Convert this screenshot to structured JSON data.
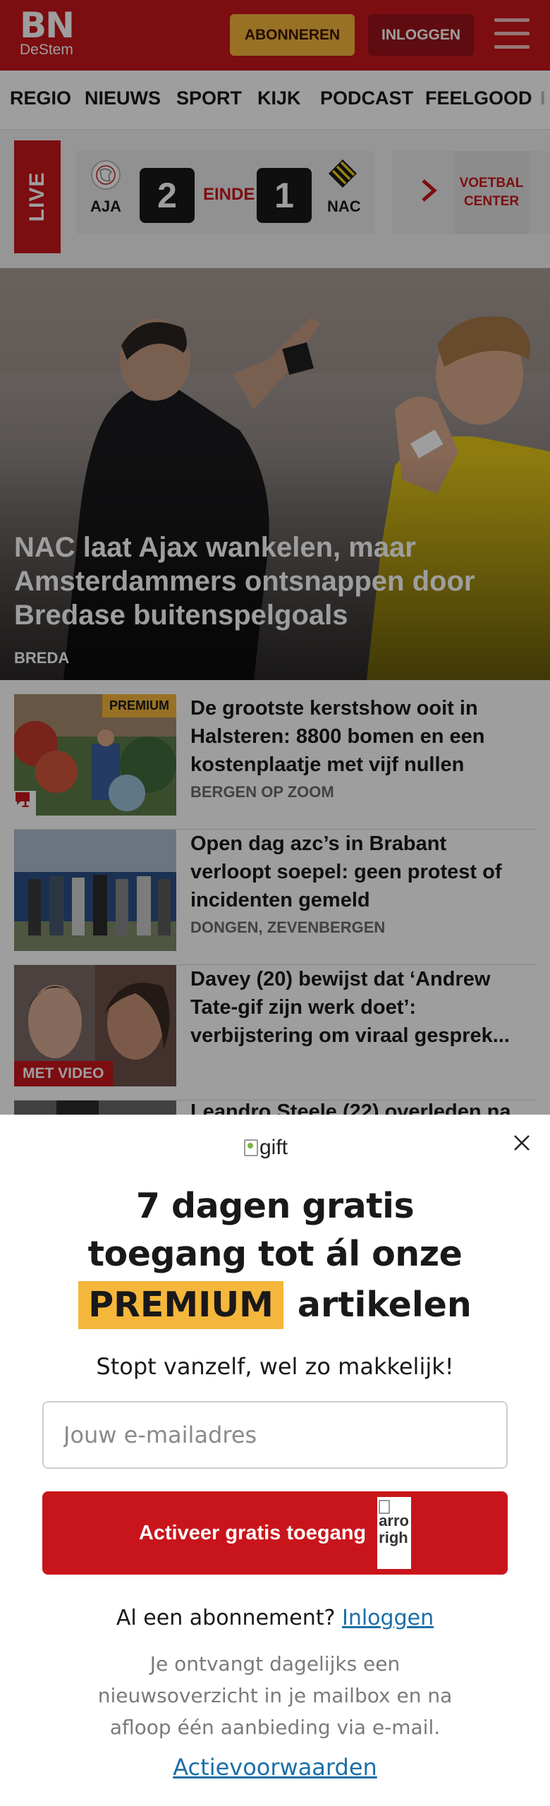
{
  "header": {
    "logo_main": "BN",
    "logo_sub": "DeStem",
    "subscribe_label": "ABONNEREN",
    "login_label": "INLOGGEN"
  },
  "nav": [
    "REGIO",
    "NIEUWS",
    "SPORT",
    "KIJK",
    "PODCAST",
    "FEELGOOD",
    "I"
  ],
  "scoreboard": {
    "live_label": "LIVE",
    "home_team": "AJA",
    "away_team": "NAC",
    "home_score": "2",
    "away_score": "1",
    "status": "EINDE",
    "center_label": "VOETBAL CENTER"
  },
  "hero": {
    "title": "NAC laat Ajax wankelen, maar Amsterdammers ontsnappen door Bredase buitenspelgoals",
    "location": "BREDA"
  },
  "articles": [
    {
      "title": "De grootste kerstshow ooit in Halsteren: 8800 bomen en een kostenplaatje met vijf nullen",
      "location": "BERGEN OP ZOOM",
      "badge": "PREMIUM",
      "comments": "1"
    },
    {
      "title": "Open dag azc’s in Brabant verloopt soepel: geen protest of incidenten gemeld",
      "location": "DONGEN, ZEVENBERGEN"
    },
    {
      "title": "Davey (20) bewijst dat ‘Andrew Tate-gif zijn werk doet’: verbijstering om viraal gesprek...",
      "badge": "MET VIDEO"
    },
    {
      "title": "Leandro Steele (22) overleden na"
    }
  ],
  "modal": {
    "gift_alt": "gift",
    "headline_1": "7 dagen gratis",
    "headline_2": "toegang tot ál onze",
    "headline_premium": "PREMIUM",
    "headline_3": "artikelen",
    "subline": "Stopt vanzelf, wel zo makkelijk!",
    "email_placeholder": "Jouw e-mailadres",
    "activate_label": "Activeer gratis toegang",
    "arrow_alt": "arrow-right",
    "arrow_alt_visible": "arro righ",
    "already_text": "Al een abonnement?",
    "login_link": "Inloggen",
    "info": "Je ontvangt dagelijks een nieuwsoverzicht in je mailbox en na afloop één aanbieding via e-mail.",
    "terms_link": "Actievoorwaarden"
  },
  "colors": {
    "brand_red": "#c8151b",
    "premium_yellow": "#f5b63c",
    "link_blue": "#1a6fa8"
  }
}
